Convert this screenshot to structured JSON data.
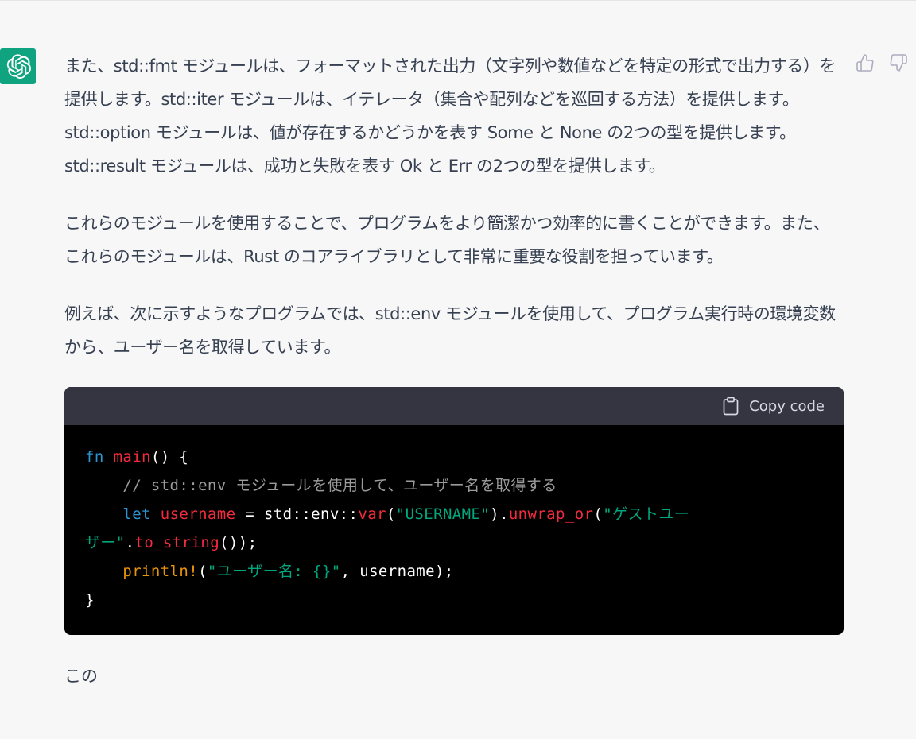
{
  "message": {
    "paragraphs": [
      "また、std::fmt モジュールは、フォーマットされた出力（文字列や数値などを特定の形式で出力する）を提供します。std::iter モジュールは、イテレータ（集合や配列などを巡回する方法）を提供します。std::option モジュールは、値が存在するかどうかを表す Some と None の2つの型を提供します。std::result モジュールは、成功と失敗を表す Ok と Err の2つの型を提供します。",
      "これらのモジュールを使用することで、プログラムをより簡潔かつ効率的に書くことができます。また、これらのモジュールは、Rust のコアライブラリとして非常に重要な役割を担っています。",
      "例えば、次に示すようなプログラムでは、std::env モジュールを使用して、プログラム実行時の環境変数から、ユーザー名を取得しています。"
    ],
    "trailing": "この"
  },
  "code_block": {
    "copy_label": "Copy code",
    "tokens": {
      "fn_kw": "fn",
      "main_name": "main",
      "main_rest": "() {",
      "comment": "// std::env モジュールを使用して、ユーザー名を取得する",
      "let_kw": "let",
      "username_var": "username",
      "assign": " = std::env::",
      "var_fn": "var",
      "paren_open": "(",
      "env_str": "\"USERNAME\"",
      "paren_close_dot": ").",
      "unwrap_fn": "unwrap_or",
      "paren_open2": "(",
      "guest_str_a": "\"ゲストユー",
      "guest_str_b": "ザー\"",
      "dot": ".",
      "to_string_fn": "to_string",
      "close_call": "());",
      "println_mac": "println!",
      "paren_open3": "(",
      "fmt_str": "\"ユーザー名: {}\"",
      "println_rest": ", username);",
      "close_brace": "}"
    }
  },
  "colors": {
    "brand": "#10a37f",
    "code_header_bg": "#343541",
    "code_bg": "#000000",
    "keyword": "#2e95d3",
    "function": "#f22c3d",
    "string": "#00a67d",
    "comment": "#9b9b9b",
    "macro": "#e9950c"
  },
  "icons": [
    "openai-logo-icon",
    "thumbs-up-icon",
    "thumbs-down-icon",
    "clipboard-icon"
  ]
}
